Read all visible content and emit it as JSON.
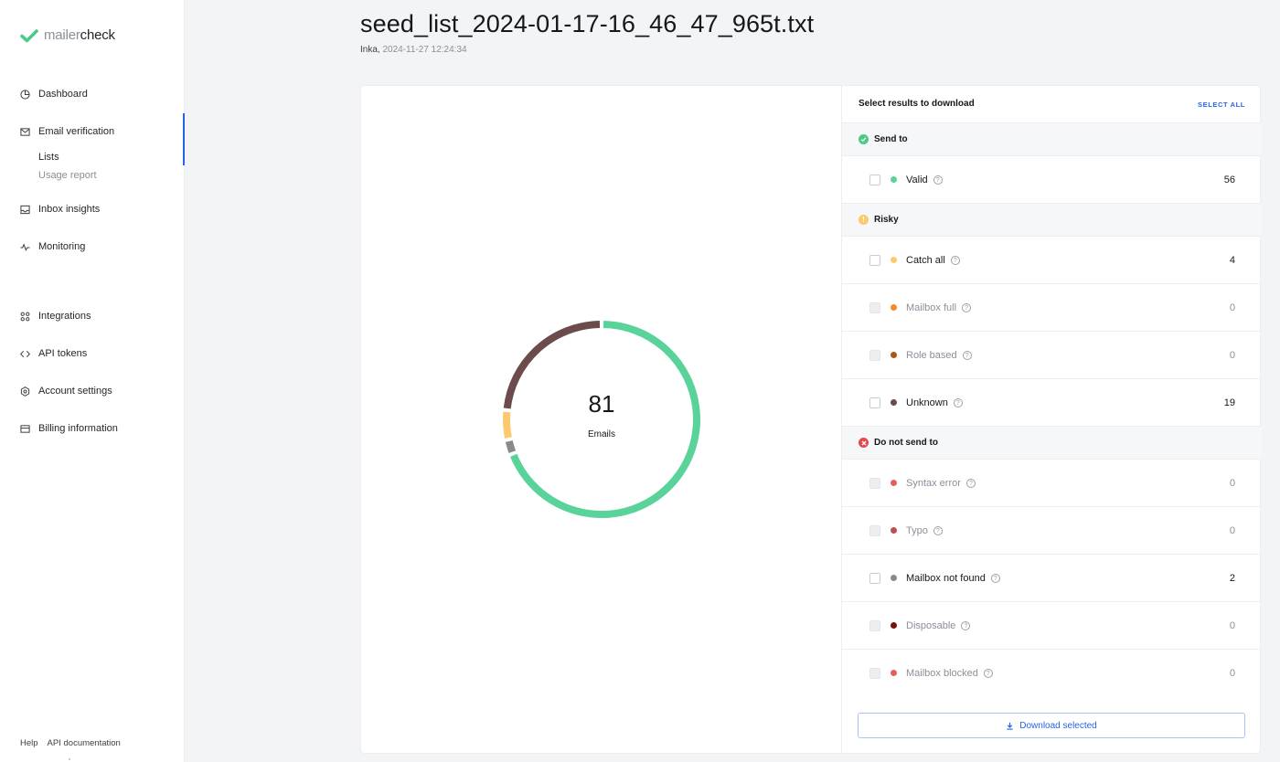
{
  "brand": {
    "name_light": "mailer",
    "name_dark": "check",
    "accent": "#4cc98b"
  },
  "sidebar": {
    "items": [
      {
        "label": "Dashboard",
        "icon": "pie-chart-icon"
      },
      {
        "label": "Email verification",
        "icon": "envelope-icon"
      },
      {
        "label": "Inbox insights",
        "icon": "inbox-icon"
      },
      {
        "label": "Monitoring",
        "icon": "activity-icon"
      },
      {
        "label": "Integrations",
        "icon": "command-icon"
      },
      {
        "label": "API tokens",
        "icon": "code-icon"
      },
      {
        "label": "Account settings",
        "icon": "gear-icon"
      },
      {
        "label": "Billing information",
        "icon": "card-icon"
      }
    ],
    "subitems": [
      {
        "label": "Lists",
        "active": true
      },
      {
        "label": "Usage report",
        "active": false
      }
    ],
    "footer": {
      "help": "Help",
      "api_docs": "API documentation"
    }
  },
  "header": {
    "title": "seed_list_2024-01-17-16_46_47_965t.txt",
    "author": "Inka,",
    "timestamp": "2024-11-27 12:24:34"
  },
  "chart": {
    "total": "81",
    "total_label": "Emails"
  },
  "chart_data": {
    "type": "pie",
    "categories": [
      "Valid",
      "Mailbox not found",
      "Catch all",
      "Unknown"
    ],
    "values": [
      56,
      2,
      4,
      19
    ],
    "colors": [
      "#5ad39b",
      "#8a8a8a",
      "#fdc96f",
      "#6b4b4b"
    ],
    "title": "",
    "total": 81
  },
  "panel": {
    "title": "Select results to download",
    "select_all": "SELECT ALL",
    "groups": [
      {
        "label": "Send to",
        "color": "#4cc98b",
        "symbol": "✓"
      },
      {
        "label": "Risky",
        "color": "#fdc96f",
        "symbol": "!"
      },
      {
        "label": "Do not send to",
        "color": "#e5484d",
        "symbol": "✕"
      }
    ],
    "rows": [
      {
        "label": "Valid",
        "count": "56",
        "color": "#5ad39b",
        "enabled": true
      },
      {
        "label": "Catch all",
        "count": "4",
        "color": "#fdc96f",
        "enabled": true
      },
      {
        "label": "Mailbox full",
        "count": "0",
        "color": "#f28c28",
        "enabled": false
      },
      {
        "label": "Role based",
        "count": "0",
        "color": "#a85a12",
        "enabled": false
      },
      {
        "label": "Unknown",
        "count": "19",
        "color": "#6b4b4b",
        "enabled": true
      },
      {
        "label": "Syntax error",
        "count": "0",
        "color": "#e5605c",
        "enabled": false
      },
      {
        "label": "Typo",
        "count": "0",
        "color": "#c0504d",
        "enabled": false
      },
      {
        "label": "Mailbox not found",
        "count": "2",
        "color": "#8a8a8a",
        "enabled": true
      },
      {
        "label": "Disposable",
        "count": "0",
        "color": "#7a1010",
        "enabled": false
      },
      {
        "label": "Mailbox blocked",
        "count": "0",
        "color": "#e5605c",
        "enabled": false
      }
    ],
    "download_label": "Download selected"
  }
}
